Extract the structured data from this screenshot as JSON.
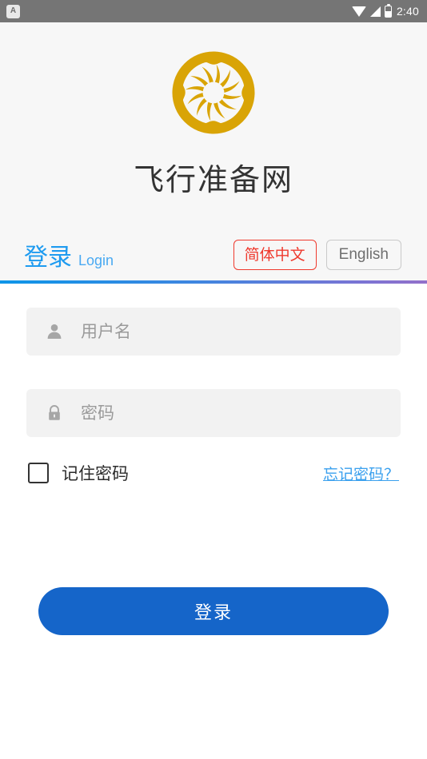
{
  "status_bar": {
    "app_badge_label": "A",
    "time": "2:40",
    "icons": [
      "wifi-icon",
      "signal-icon",
      "battery-icon"
    ],
    "background_color": "#757575"
  },
  "brand": {
    "logo_name": "golden-sun-bird-logo",
    "logo_color": "#d9a406",
    "title": "飞行准备网"
  },
  "header": {
    "tab_label_cn": "登录",
    "tab_label_en": "Login",
    "tab_color": "#1e9bf0",
    "languages": [
      {
        "label": "简体中文",
        "selected": true,
        "color": "#ef3a2e"
      },
      {
        "label": "English",
        "selected": false,
        "color": "#6f6f6f"
      }
    ],
    "divider_gradient_from": "#0d95e8",
    "divider_gradient_to": "#9370c9"
  },
  "form": {
    "username": {
      "icon": "person-icon",
      "value": "",
      "placeholder": "用户名"
    },
    "password": {
      "icon": "lock-icon",
      "value": "",
      "placeholder": "密码"
    },
    "remember": {
      "label": "记住密码",
      "checked": false
    },
    "forgot_label": "忘记密码？",
    "forgot_color": "#3aa0ee",
    "submit_label": "登录",
    "submit_color": "#1565c9"
  }
}
